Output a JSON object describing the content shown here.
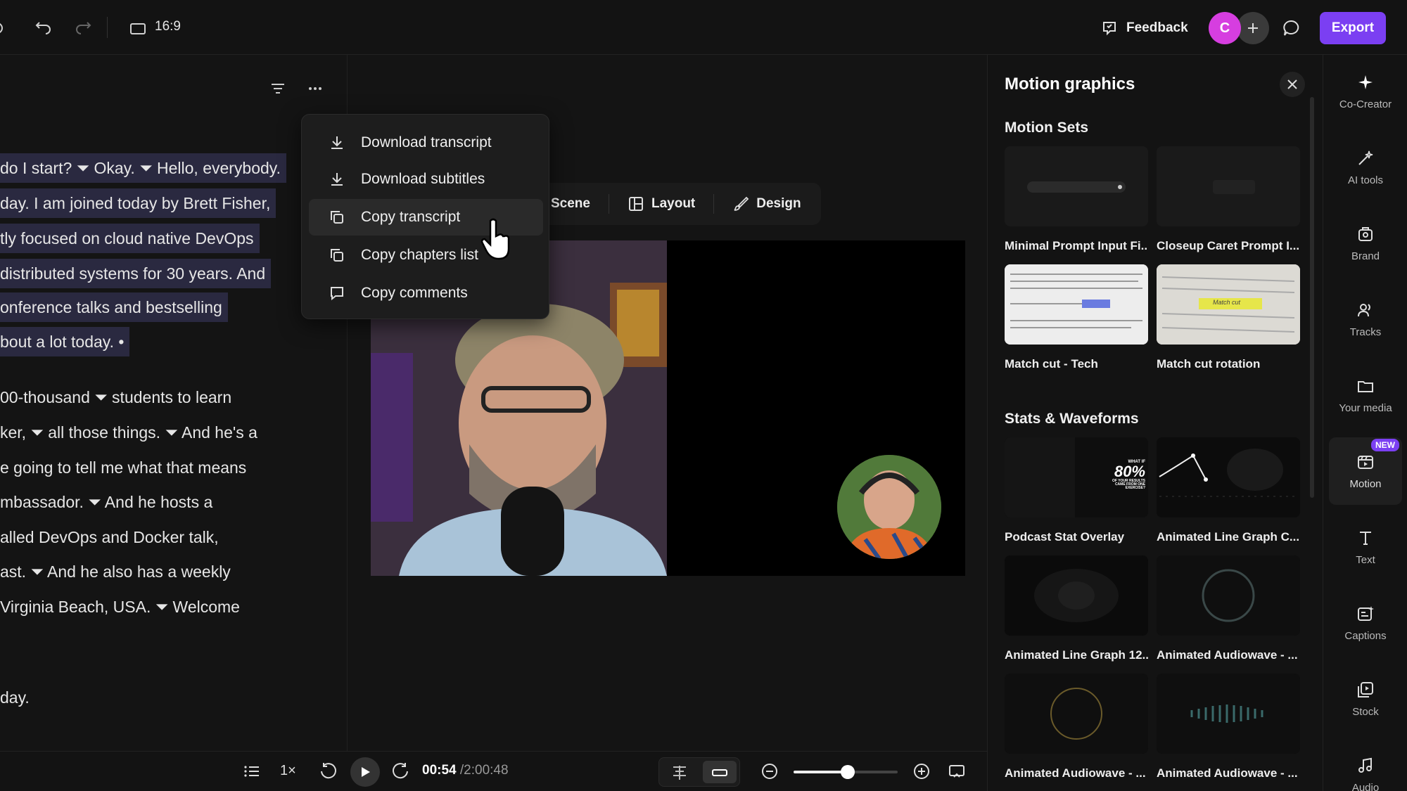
{
  "topbar": {
    "aspect_ratio": "16:9",
    "feedback_label": "Feedback",
    "avatar_initial": "C",
    "export_label": "Export"
  },
  "transcript": {
    "lines": [
      "do I start? ⏷ Okay. ⏷ Hello, everybody.",
      "day. I am joined today by Brett Fisher,",
      "tly focused on cloud native DevOps",
      "distributed systems for 30 years. And",
      "onference talks and bestselling",
      "bout a lot today. •",
      "00-thousand ⏷ students to learn",
      "ker, ⏷ all those things. ⏷ And he's a",
      "e going to tell me what that means",
      "mbassador. ⏷ And he hosts a",
      "alled DevOps and Docker talk,",
      "ast. ⏷ And he also has a weekly",
      " Virginia Beach, USA. ⏷ Welcome",
      "day."
    ]
  },
  "menu": {
    "items": [
      {
        "label": "Download transcript",
        "icon": "download-icon"
      },
      {
        "label": "Download subtitles",
        "icon": "download-icon"
      },
      {
        "label": "Copy transcript",
        "icon": "copy-icon"
      },
      {
        "label": "Copy chapters list",
        "icon": "copy-icon"
      },
      {
        "label": "Copy comments",
        "icon": "comment-icon"
      }
    ]
  },
  "scene_toolbar": {
    "scene": "Scene",
    "layout": "Layout",
    "design": "Design"
  },
  "playback": {
    "speed": "1×",
    "current_time": "00:54",
    "total_time": "/2:00:48",
    "zoom_level": 0.52
  },
  "panel": {
    "title": "Motion graphics",
    "sections": [
      {
        "title": "Motion Sets",
        "items": [
          "Minimal Prompt Input Fi...",
          "Closeup Caret Prompt I...",
          "Match cut - Tech",
          "Match cut rotation"
        ]
      },
      {
        "title": "Stats & Waveforms",
        "items": [
          "Podcast Stat Overlay",
          "Animated Line Graph C...",
          "Animated Line Graph 12...",
          "Animated Audiowave - ...",
          "Animated Audiowave - ...",
          "Animated Audiowave - ..."
        ]
      }
    ],
    "stat_overlay": {
      "line1": "WHAT IF",
      "percent": "80%",
      "line2": "OF YOUR RESULTS",
      "line3": "CAME FROM ONE",
      "line4": "EXERCISE?"
    },
    "match_cut_tag": "Match cut"
  },
  "rail": {
    "items": [
      {
        "label": "Co-Creator",
        "icon": "sparkle-icon"
      },
      {
        "label": "AI tools",
        "icon": "ai-tools-icon"
      },
      {
        "label": "Brand",
        "icon": "brand-icon"
      },
      {
        "label": "Tracks",
        "icon": "tracks-icon"
      },
      {
        "label": "Your media",
        "icon": "folder-icon"
      },
      {
        "label": "Motion",
        "icon": "motion-icon",
        "badge": "NEW"
      },
      {
        "label": "Text",
        "icon": "text-icon"
      },
      {
        "label": "Captions",
        "icon": "captions-icon"
      },
      {
        "label": "Stock",
        "icon": "stock-icon"
      },
      {
        "label": "Audio",
        "icon": "music-icon"
      }
    ]
  },
  "colors": {
    "accent": "#7b3ff2",
    "avatar": "#d63ee0",
    "selection": "#2a2940"
  }
}
